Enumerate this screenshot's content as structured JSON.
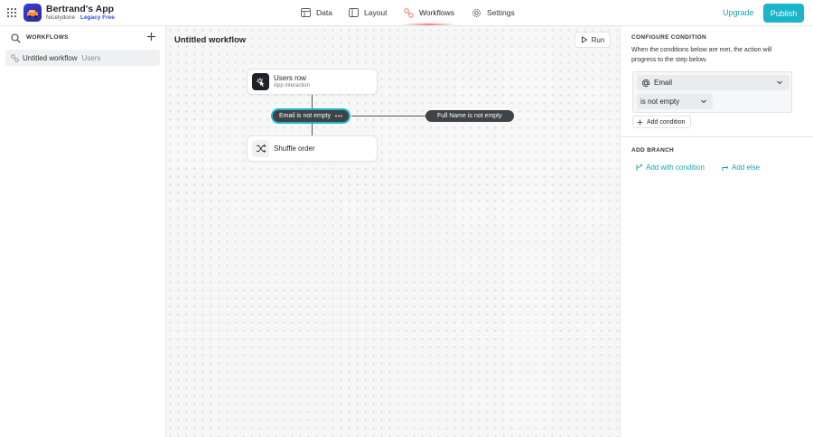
{
  "app": {
    "name": "Bertrand's App",
    "workspace": "Nicelydone",
    "separator": "·",
    "plan": "Legacy Free"
  },
  "nav": {
    "data": "Data",
    "layout": "Layout",
    "workflows": "Workflows",
    "settings": "Settings",
    "active": "Workflows"
  },
  "topbar": {
    "upgrade": "Upgrade",
    "publish": "Publish"
  },
  "sidebar": {
    "title": "WORKFLOWS",
    "items": [
      {
        "label": "Untitled workflow",
        "sub": "Users"
      }
    ]
  },
  "canvas": {
    "title": "Untitled workflow",
    "run": "Run",
    "trigger": {
      "title": "Users row",
      "subtitle": "App interaction"
    },
    "branches": [
      {
        "label": "Email is not empty",
        "selected": true
      },
      {
        "label": "Full Name is not empty",
        "selected": false
      }
    ],
    "action": {
      "title": "Shuffle order"
    }
  },
  "panel": {
    "heading": "CONFIGURE CONDITION",
    "description": "When the conditions below are met, the action will progress to the step below.",
    "field": "Email",
    "operator": "is not empty",
    "add_condition": "Add condition",
    "branch_heading": "ADD BRANCH",
    "add_with_condition": "Add with condition",
    "add_else": "Add else"
  },
  "colors": {
    "accent": "#1bb5c9",
    "link": "#1aa3b5",
    "pill": "#3e4347",
    "active_nav": "#ff7a70",
    "plan_link": "#2b55d6"
  },
  "icons": {
    "app_grid": "grid-icon",
    "data": "table-icon",
    "layout": "layout-icon",
    "workflows": "workflow-icon",
    "settings": "gear-icon",
    "search": "search-icon",
    "add": "plus-icon",
    "run": "play-icon",
    "trigger": "touch-icon",
    "action": "shuffle-icon",
    "field": "at-icon",
    "branch": "branch-icon"
  }
}
